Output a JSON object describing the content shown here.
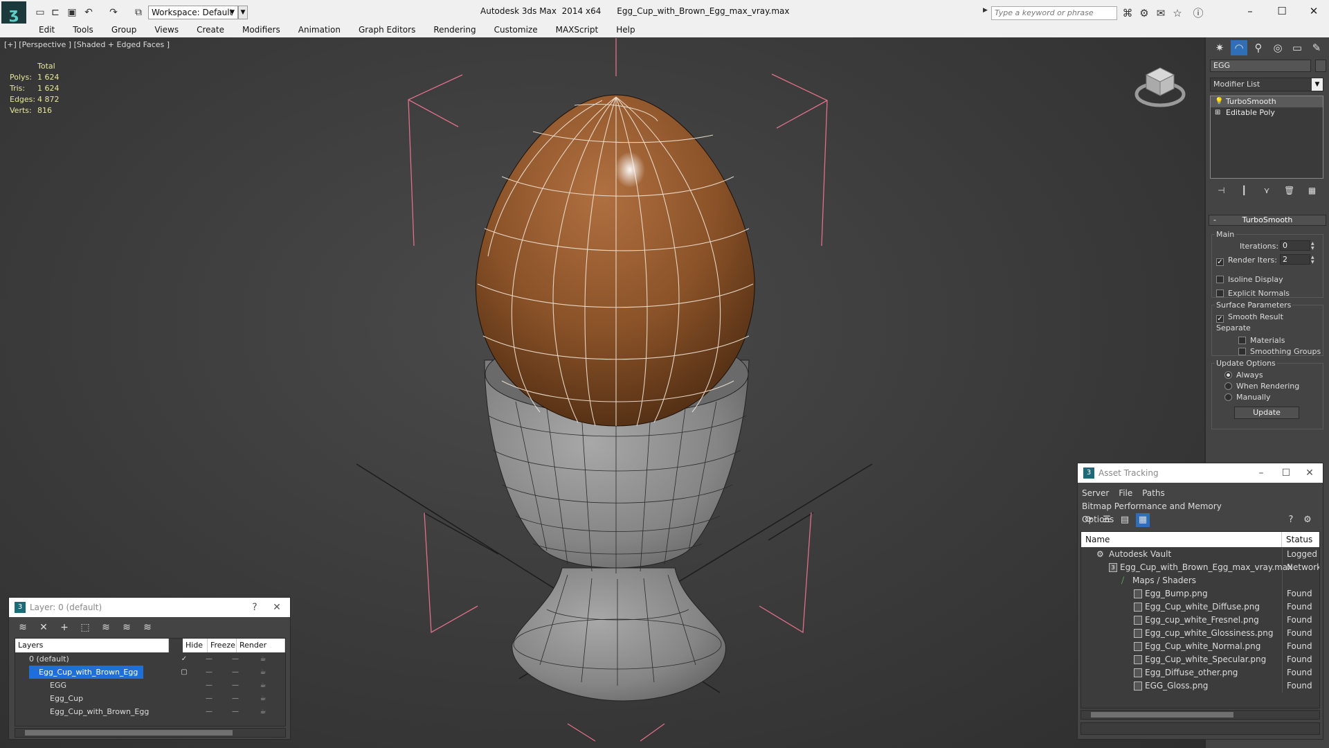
{
  "titlebar": {
    "workspace": "Workspace: Default",
    "app_title": "Autodesk 3ds Max  2014 x64",
    "file_name": "Egg_Cup_with_Brown_Egg_max_vray.max",
    "search_placeholder": "Type a keyword or phrase"
  },
  "menu": [
    "Edit",
    "Tools",
    "Group",
    "Views",
    "Create",
    "Modifiers",
    "Animation",
    "Graph Editors",
    "Rendering",
    "Customize",
    "MAXScript",
    "Help"
  ],
  "viewport": {
    "label": "[+] [Perspective ] [Shaded + Edged Faces ]",
    "stats_header": "Total",
    "stats": [
      {
        "label": "Polys:",
        "value": "1 624"
      },
      {
        "label": "Tris:",
        "value": "1 624"
      },
      {
        "label": "Edges:",
        "value": "4 872"
      },
      {
        "label": "Verts:",
        "value": "816"
      }
    ]
  },
  "command_panel": {
    "object_name": "EGG",
    "modifier_list": "Modifier List",
    "stack": [
      "TurboSmooth",
      "Editable Poly"
    ],
    "rollout_title": "TurboSmooth",
    "main_group": "Main",
    "iterations_label": "Iterations:",
    "iterations_value": "0",
    "render_iters_label": "Render Iters:",
    "render_iters_value": "2",
    "isoline_display": "Isoline Display",
    "explicit_normals": "Explicit Normals",
    "surface_params": "Surface Parameters",
    "smooth_result": "Smooth Result",
    "separate": "Separate",
    "materials": "Materials",
    "smoothing_groups": "Smoothing Groups",
    "update_options": "Update Options",
    "always": "Always",
    "when_rendering": "When Rendering",
    "manually": "Manually",
    "update_button": "Update"
  },
  "layer_manager": {
    "title": "Layer: 0 (default)",
    "help": "?",
    "columns": [
      "Layers",
      "Hide",
      "Freeze",
      "Render"
    ],
    "rows": [
      {
        "name": "0 (default)",
        "indent": 0
      },
      {
        "name": "Egg_Cup_with_Brown_Egg",
        "indent": 0
      },
      {
        "name": "EGG",
        "indent": 1
      },
      {
        "name": "Egg_Cup",
        "indent": 1
      },
      {
        "name": "Egg_Cup_with_Brown_Egg",
        "indent": 1
      }
    ]
  },
  "asset_tracking": {
    "title": "Asset Tracking",
    "menu": [
      "Server",
      "File",
      "Paths",
      "Bitmap Performance and Memory",
      "Options"
    ],
    "columns": [
      "Name",
      "Status"
    ],
    "rows": [
      {
        "name": "Autodesk Vault",
        "status": "Logged C",
        "indent": 0
      },
      {
        "name": "Egg_Cup_with_Brown_Egg_max_vray.max",
        "status": "Network I",
        "indent": 1
      },
      {
        "name": "Maps / Shaders",
        "status": "",
        "indent": 2
      },
      {
        "name": "Egg_Bump.png",
        "status": "Found",
        "indent": 3
      },
      {
        "name": "Egg_Cup_white_Diffuse.png",
        "status": "Found",
        "indent": 3
      },
      {
        "name": "Egg_cup_white_Fresnel.png",
        "status": "Found",
        "indent": 3
      },
      {
        "name": "Egg_cup_white_Glossiness.png",
        "status": "Found",
        "indent": 3
      },
      {
        "name": "Egg_Cup_white_Normal.png",
        "status": "Found",
        "indent": 3
      },
      {
        "name": "Egg_Cup_white_Specular.png",
        "status": "Found",
        "indent": 3
      },
      {
        "name": "Egg_Diffuse_other.png",
        "status": "Found",
        "indent": 3
      },
      {
        "name": "EGG_Gloss.png",
        "status": "Found",
        "indent": 3
      }
    ]
  },
  "colors": {
    "egg": "#8a5228",
    "cup": "#8c8c8c",
    "selection_blue": "#1e6fd8",
    "bbox_pink": "#e0708a"
  }
}
